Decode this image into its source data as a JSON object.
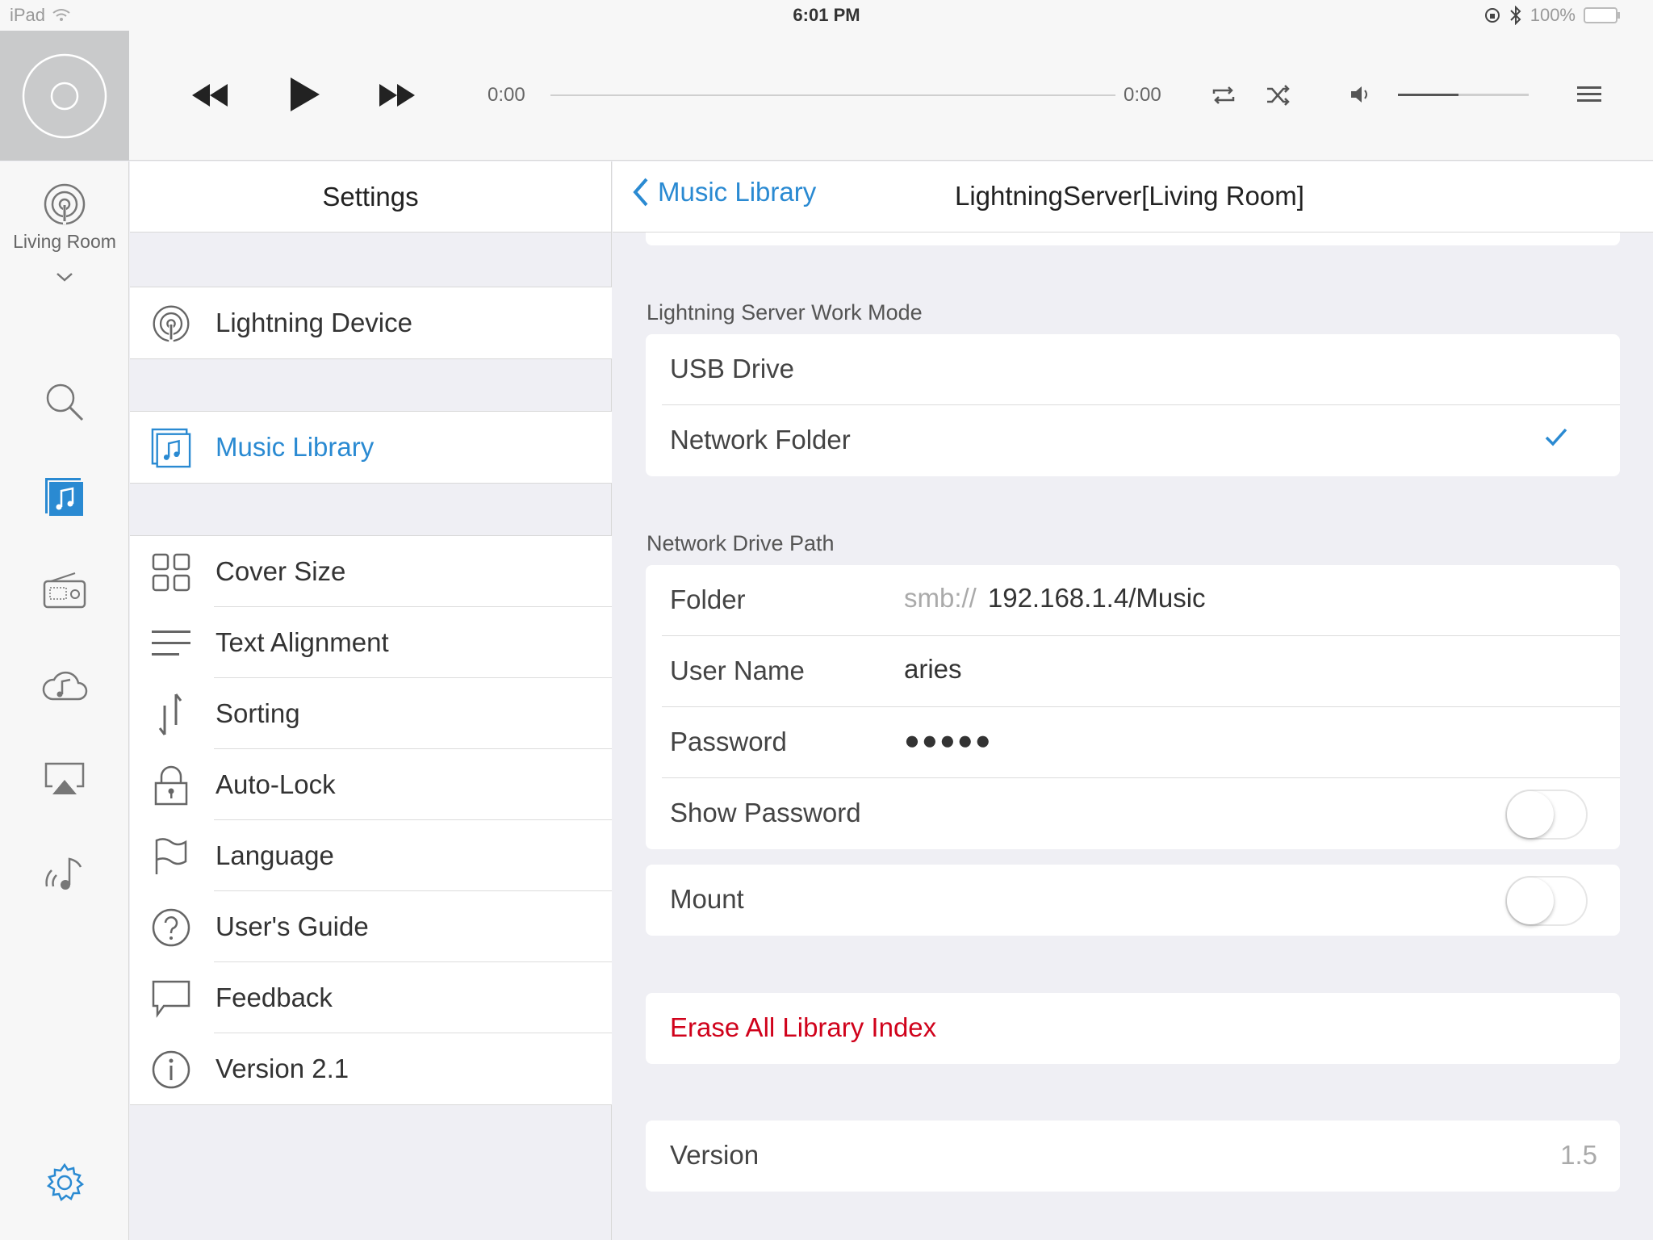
{
  "status_bar": {
    "carrier": "iPad",
    "time": "6:01 PM",
    "battery": "100%",
    "icons": [
      "wifi-icon",
      "lock-rotation-icon",
      "bluetooth-icon",
      "battery-icon"
    ]
  },
  "player": {
    "elapsed": "0:00",
    "duration": "0:00",
    "progress": 0,
    "volume": 0.46,
    "icons": [
      "album-art-placeholder-icon",
      "rewind-icon",
      "play-icon",
      "fast-forward-icon",
      "repeat-icon",
      "shuffle-icon",
      "volume-icon",
      "menu-icon"
    ]
  },
  "rail": {
    "room": "Living Room",
    "items": [
      "lightning-device-icon",
      "search-icon",
      "music-library-icon",
      "radio-icon",
      "cloud-music-icon",
      "airplay-icon",
      "streaming-music-icon",
      "settings-gear-icon"
    ]
  },
  "settings": {
    "title": "Settings",
    "group1": [
      {
        "label": "Lightning Device",
        "icon": "lightning-device-icon"
      }
    ],
    "group2": [
      {
        "label": "Music Library",
        "icon": "music-library-icon"
      }
    ],
    "group3": [
      {
        "label": "Cover Size",
        "icon": "grid-icon"
      },
      {
        "label": "Text Alignment",
        "icon": "text-align-icon"
      },
      {
        "label": "Sorting",
        "icon": "sort-icon"
      },
      {
        "label": "Auto-Lock",
        "icon": "lock-icon"
      },
      {
        "label": "Language",
        "icon": "flag-icon"
      },
      {
        "label": "User's Guide",
        "icon": "help-icon"
      },
      {
        "label": "Feedback",
        "icon": "chat-bubble-icon"
      },
      {
        "label": "Version 2.1",
        "icon": "info-icon"
      }
    ]
  },
  "detail": {
    "back_label": "Music Library",
    "title": "LightningServer[Living Room]",
    "work_mode": {
      "section_label": "Lightning Server Work Mode",
      "options": [
        "USB Drive",
        "Network Folder"
      ],
      "selected": "Network Folder"
    },
    "network": {
      "section_label": "Network Drive Path",
      "folder_label": "Folder",
      "folder_prefix": "smb://",
      "folder_value": "192.168.1.4/Music",
      "user_label": "User Name",
      "user_value": "aries",
      "password_label": "Password",
      "password_value": "●●●●●",
      "show_password_label": "Show Password",
      "show_password_on": false
    },
    "mount_label": "Mount",
    "mount_on": false,
    "erase_label": "Erase All Library Index",
    "version_label": "Version",
    "version_value": "1.5"
  },
  "colors": {
    "accent": "#2a8ad2",
    "danger": "#d0021b",
    "background": "#efeff4"
  }
}
